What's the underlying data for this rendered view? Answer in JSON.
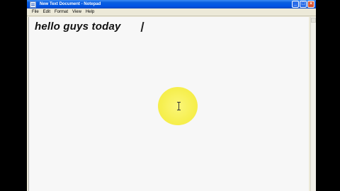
{
  "window": {
    "title": "New Text Document - Notepad",
    "app_icon": "notepad-icon",
    "buttons": {
      "minimize": "_",
      "maximize": "□",
      "close": "×"
    }
  },
  "menubar": {
    "items": [
      {
        "label": "File"
      },
      {
        "label": "Edit"
      },
      {
        "label": "Format"
      },
      {
        "label": "View"
      },
      {
        "label": "Help"
      }
    ]
  },
  "editor": {
    "text": "hello guys today"
  },
  "overlay": {
    "click_highlight_color": "#f6ef4f",
    "cursor_icon": "ibeam-cursor-icon"
  }
}
